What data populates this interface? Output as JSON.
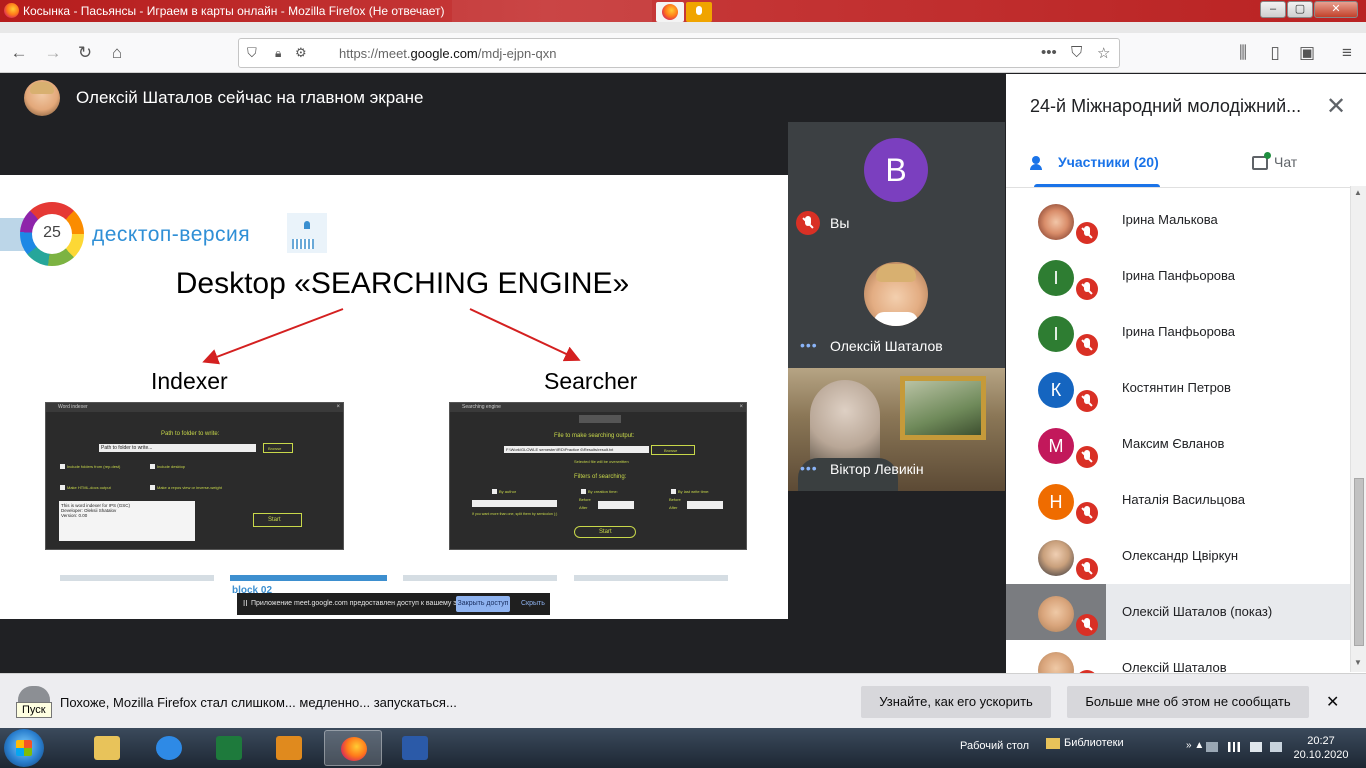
{
  "window": {
    "title": "Косынка - Пасьянсы - Играем в карты онлайн - Mozilla Firefox (Не отвечает)",
    "controls": [
      "–",
      "▢",
      "✕"
    ]
  },
  "nav": {
    "url_prefix": "https://meet.",
    "url_domain": "google.com",
    "url_path": "/mdj-ejpn-qxn"
  },
  "meet": {
    "presenter_text": "Олексій Шаталов сейчас на главном экране",
    "slide": {
      "logo_number": "25",
      "logo_text": "десктоп-версия",
      "title": "Desktop «SEARCHING ENGINE»",
      "label_left": "Indexer",
      "label_right": "Searcher",
      "indexer_window": {
        "title": "Word indexer",
        "path_label": "Path to folder to write:",
        "path_value": "Path to folder to write...",
        "browse": "Browse",
        "opt1": "Include folders from (rep.dest)",
        "opt2": "Include desktop",
        "opt3": "Make HTML-docs output",
        "opt4": "Make a repos view or inverse-weight",
        "log_line1": "This is word indexer for IPS (GSC)",
        "log_line2": "Developer: Oleksii Shatalov",
        "log_line3": "Version: 0.00",
        "start": "Start"
      },
      "searcher_window": {
        "title": "Searching engine",
        "file_label": "File to make searching output:",
        "file_value": "F:\\Work\\GLOWLE semester\\IRD\\Practice 6\\Results\\result.txt",
        "browse": "Browse",
        "hint": "Selected file will be overwritten",
        "filters_label": "Filters of searching:",
        "by_author": "By author",
        "by_creation": "By creation time:",
        "by_last_write": "By last write time:",
        "before": "Before",
        "after": "After",
        "note": "If you want more than one, split them by semicolon (;)",
        "start": "Start"
      },
      "bottom_label": "block 02"
    },
    "share_notice": {
      "pause": "II",
      "message": "Приложение meet.google.com предоставлен доступ к вашему экрану.",
      "stop": "Закрыть доступ",
      "hide": "Скрыть"
    },
    "tiles": [
      {
        "name": "Вы",
        "avatar_letter": "В"
      },
      {
        "name": "Олексій Шаталов",
        "dots": "•••"
      },
      {
        "name": "Віктор Левикін",
        "dots": "•••"
      }
    ]
  },
  "panel": {
    "title": "24-й Міжнародний молодіжний...",
    "close": "✕",
    "tab_people": "Участники (20)",
    "tab_chat": "Чат",
    "participants": [
      {
        "name": "Ірина Малькова",
        "letter": "",
        "color": "#e57373",
        "photo": "photo-w"
      },
      {
        "name": "Ірина Панфьорова",
        "letter": "І",
        "color": "#2e7d32"
      },
      {
        "name": "Ірина Панфьорова",
        "letter": "І",
        "color": "#2e7d32"
      },
      {
        "name": "Костянтин Петров",
        "letter": "К",
        "color": "#1565c0"
      },
      {
        "name": "Максим Євланов",
        "letter": "М",
        "color": "#c2185b"
      },
      {
        "name": "Наталія Васильцова",
        "letter": "Н",
        "color": "#ef6c00"
      },
      {
        "name": "Олександр Цвіркун",
        "letter": "",
        "color": "#37474f",
        "photo": "photo-m"
      },
      {
        "name": "Олексій Шаталов (показ)",
        "letter": "",
        "color": "#9e9e9e",
        "photo": "photo-o"
      },
      {
        "name": "Олексій Шаталов",
        "letter": "",
        "color": "#9e9e9e",
        "photo": "photo-o"
      }
    ]
  },
  "notification": {
    "tooltip": "Пуск",
    "message": "Похоже, Mozilla Firefox стал слишком... медленно... запускаться...",
    "btn_speed": "Узнайте, как его ускорить",
    "btn_dismiss": "Больше мне об этом не сообщать",
    "close": "✕"
  },
  "taskbar": {
    "desktop": "Рабочий стол",
    "libraries": "Библиотеки",
    "tray_arrows": "» ▲",
    "time": "20:27",
    "date": "20.10.2020"
  },
  "colors": {
    "accent": "#1a73e8",
    "mic_off": "#d93025",
    "meet_bg": "#202124"
  }
}
